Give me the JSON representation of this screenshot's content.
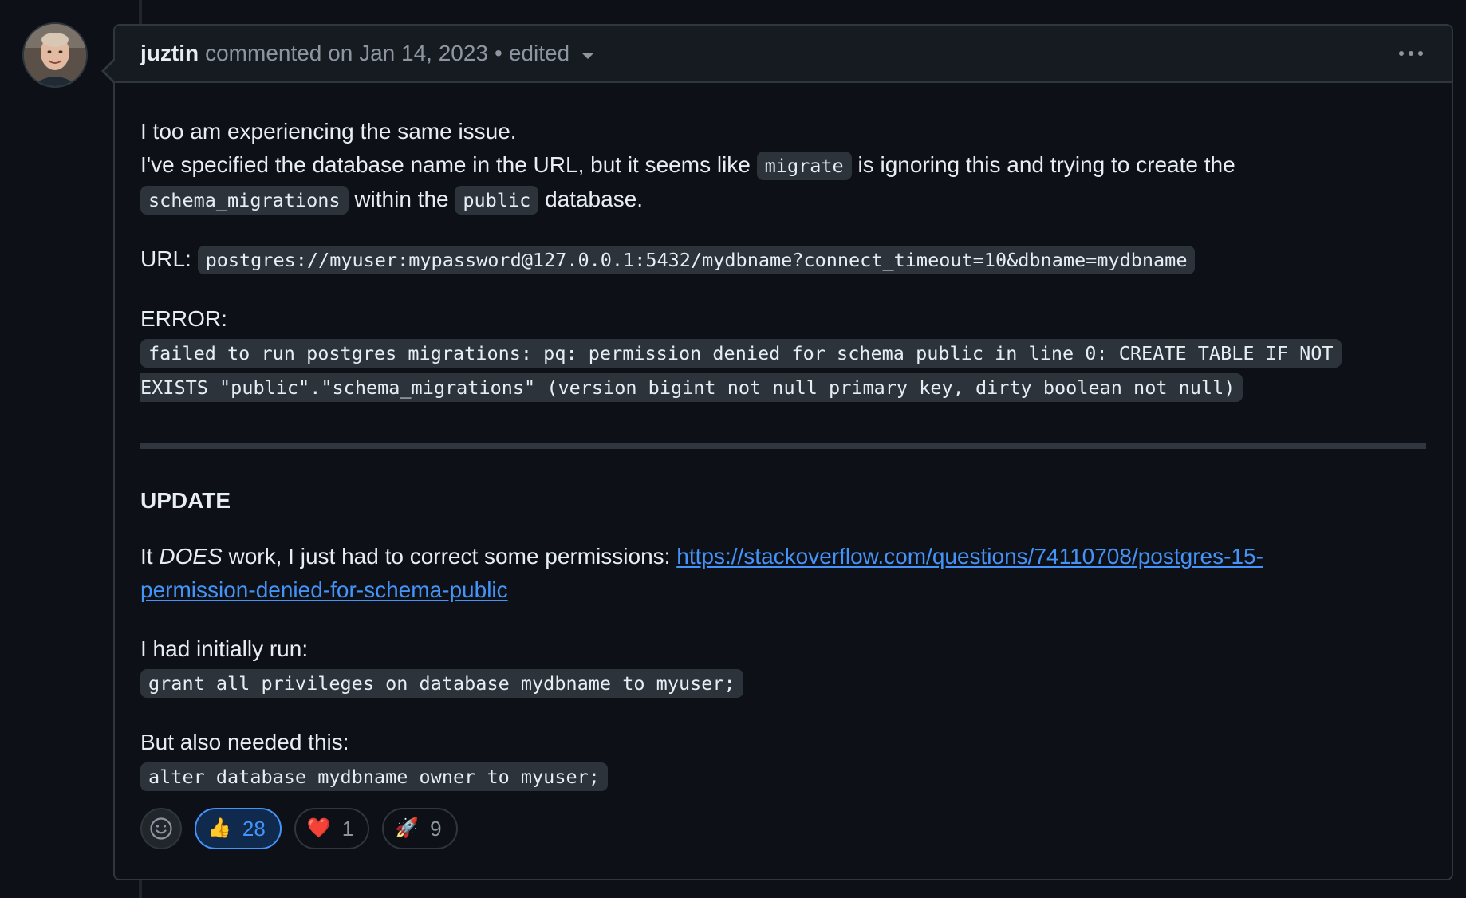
{
  "comment": {
    "author": "juztin",
    "action_text": "commented on Jan 14, 2023",
    "separator": "•",
    "edited_label": "edited",
    "avatar_icon": "user-avatar"
  },
  "body": {
    "p1_line1": "I too am experiencing the same issue.",
    "p1_line2_a": "I've specified the database name in the URL, but it seems like",
    "p1_code_migrate": "migrate",
    "p1_line2_b": "is ignoring this and trying to create the",
    "p1_code_schema": "schema_migrations",
    "p1_line3_a": "within the",
    "p1_code_public": "public",
    "p1_line3_b": "database.",
    "url_label": "URL:",
    "url_code": "postgres://myuser:mypassword@127.0.0.1:5432/mydbname?connect_timeout=10&dbname=mydbname",
    "error_label": "ERROR:",
    "error_code_line1": "failed to run postgres migrations: pq: permission denied for schema public in line 0: CREATE TABLE IF NOT",
    "error_code_line2": "EXISTS \"public\".\"schema_migrations\" (version bigint not null primary key, dirty boolean not null)",
    "update_heading": "UPDATE",
    "update_a": "It",
    "update_em": "DOES",
    "update_b": "work, I just had to correct some permissions:",
    "update_link_line1": "https://stackoverflow.com/questions/74110708/postgres-15-",
    "update_link_line2": "permission-denied-for-schema-public",
    "initial_label": "I had initially run:",
    "initial_code": "grant all privileges on database mydbname to myuser;",
    "also_label": "But also needed this:",
    "also_code": "alter database mydbname owner to myuser;"
  },
  "reactions": [
    {
      "emoji": "👍",
      "icon": "thumbs-up-icon",
      "count": "28",
      "active": true
    },
    {
      "emoji": "❤️",
      "icon": "heart-icon",
      "count": "1",
      "active": false
    },
    {
      "emoji": "🚀",
      "icon": "rocket-icon",
      "count": "9",
      "active": false
    }
  ],
  "colors": {
    "background": "#0d1117",
    "header_bg": "#161b22",
    "border": "#30363d",
    "link": "#4493f8",
    "muted_text": "#8d96a0",
    "code_bg": "#2d333b"
  }
}
